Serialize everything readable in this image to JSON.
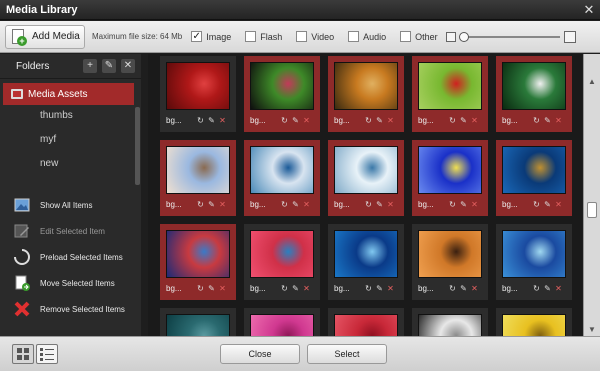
{
  "window": {
    "title": "Media Library",
    "close_glyph": "✕"
  },
  "toolbar": {
    "add_media_label": "Add Media",
    "max_file_size": "Maximum file size: 64 Mb",
    "filters": [
      {
        "label": "Image",
        "checked": true
      },
      {
        "label": "Flash",
        "checked": false
      },
      {
        "label": "Video",
        "checked": false
      },
      {
        "label": "Audio",
        "checked": false
      },
      {
        "label": "Other",
        "checked": false
      }
    ],
    "thumb_size_level": 0
  },
  "sidebar": {
    "folders_label": "Folders",
    "root_folder": "Media Assets",
    "subfolders": [
      "thumbs",
      "myf",
      "new"
    ],
    "actions": [
      {
        "label": "Show All Items",
        "icon": "image-icon",
        "enabled": true
      },
      {
        "label": "Edit Selected Item",
        "icon": "edit-icon",
        "enabled": false
      },
      {
        "label": "Preload Selected Items",
        "icon": "spinner-icon",
        "enabled": true
      },
      {
        "label": "Move Selected Items",
        "icon": "move-icon",
        "enabled": true
      },
      {
        "label": "Remove Selected Items",
        "icon": "remove-icon",
        "enabled": true
      }
    ]
  },
  "gallery": {
    "items": [
      {
        "name": "bg...",
        "selected": false,
        "colors": [
          "#b01818",
          "#5a0a0a",
          "#e04040"
        ]
      },
      {
        "name": "bg...",
        "selected": true,
        "colors": [
          "#3e8a28",
          "#0e0e0e",
          "#c23a5a"
        ]
      },
      {
        "name": "bg...",
        "selected": true,
        "colors": [
          "#c87a20",
          "#3a2a10",
          "#e0b060"
        ]
      },
      {
        "name": "bg...",
        "selected": true,
        "colors": [
          "#78b830",
          "#a8d060",
          "#d02020"
        ]
      },
      {
        "name": "bg...",
        "selected": true,
        "colors": [
          "#2a7a3a",
          "#0a2a10",
          "#f0f0f0"
        ]
      },
      {
        "name": "bg...",
        "selected": true,
        "colors": [
          "#9ab8e0",
          "#f0e0d0",
          "#8a6a50"
        ]
      },
      {
        "name": "bg...",
        "selected": true,
        "colors": [
          "#d8e4f0",
          "#4a8ab8",
          "#1a5a98"
        ]
      },
      {
        "name": "bg...",
        "selected": true,
        "colors": [
          "#e8f2f8",
          "#80aac8",
          "#3a78a8"
        ]
      },
      {
        "name": "bg...",
        "selected": true,
        "colors": [
          "#1a30c8",
          "#6a8af0",
          "#f0e050"
        ]
      },
      {
        "name": "bg...",
        "selected": true,
        "colors": [
          "#0a3a78",
          "#1a68b8",
          "#c09030"
        ]
      },
      {
        "name": "bg...",
        "selected": true,
        "colors": [
          "#c83a40",
          "#1a2a78",
          "#3a7ac8"
        ]
      },
      {
        "name": "bg...",
        "selected": false,
        "colors": [
          "#d03048",
          "#f05070",
          "#2a80c0"
        ]
      },
      {
        "name": "bg...",
        "selected": false,
        "colors": [
          "#0a3a88",
          "#1a78c8",
          "#80c8f0"
        ]
      },
      {
        "name": "bg...",
        "selected": false,
        "colors": [
          "#d07828",
          "#f0a050",
          "#3a2010"
        ]
      },
      {
        "name": "bg...",
        "selected": false,
        "colors": [
          "#1a4aa0",
          "#3a90d8",
          "#a0d8f0"
        ]
      },
      {
        "name": "",
        "selected": false,
        "colors": [
          "#2a6a70",
          "#0a3a40",
          "#5a9aa0"
        ]
      },
      {
        "name": "",
        "selected": false,
        "colors": [
          "#d03890",
          "#f070b0",
          "#901858"
        ]
      },
      {
        "name": "",
        "selected": false,
        "colors": [
          "#c82838",
          "#e85868",
          "#901020"
        ]
      },
      {
        "name": "",
        "selected": false,
        "colors": [
          "#e8e8e8",
          "#1a1a1a",
          "#8a8a8a"
        ]
      },
      {
        "name": "",
        "selected": false,
        "colors": [
          "#e8c020",
          "#f0e060",
          "#806010"
        ]
      }
    ]
  },
  "footer": {
    "close_label": "Close",
    "select_label": "Select",
    "view_mode": "grid"
  }
}
